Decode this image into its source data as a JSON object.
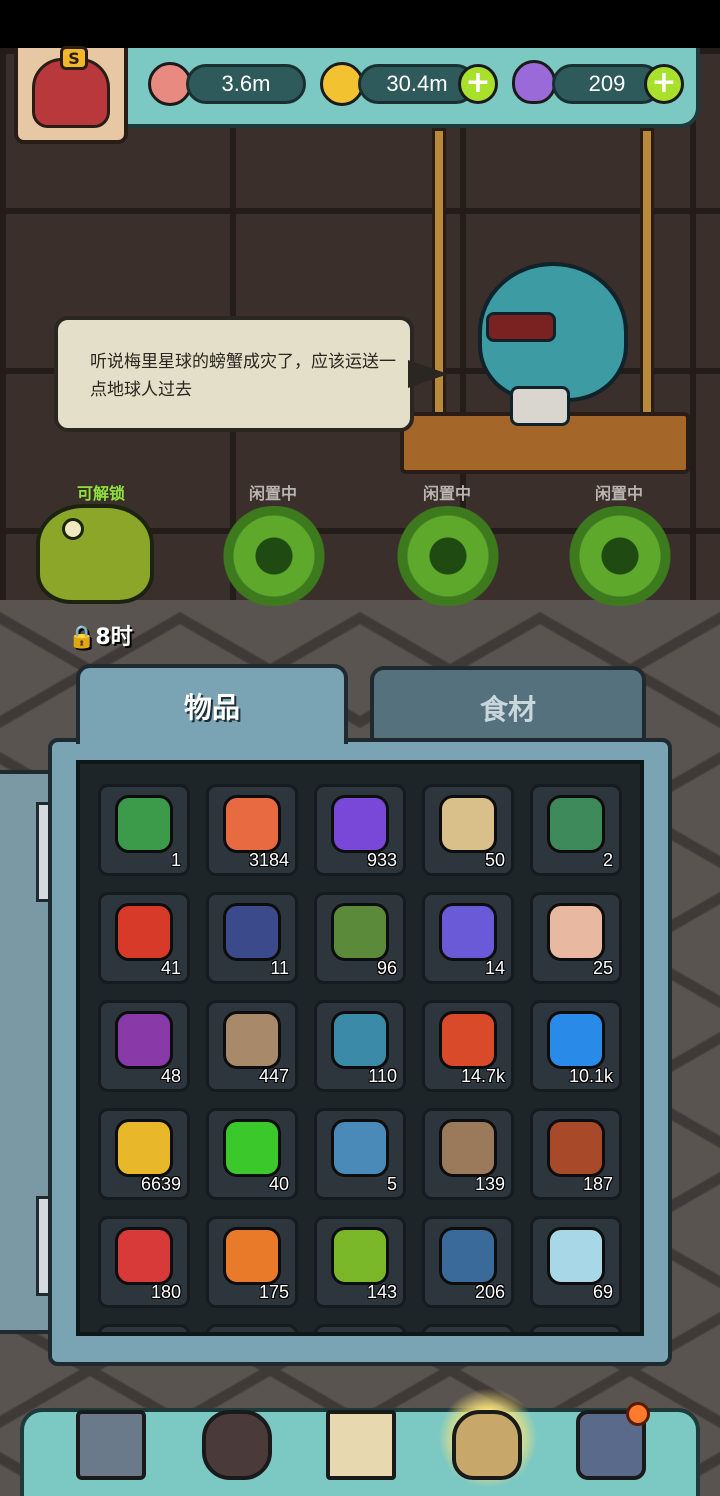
{
  "header": {
    "avatar_badge": "S",
    "resources": [
      {
        "name": "eye-currency",
        "value": "3.6m",
        "icon": "eyeball-icon",
        "color": "#e88a80"
      },
      {
        "name": "gold-coin",
        "value": "30.4m",
        "icon": "coin-icon",
        "color": "#f2c230"
      },
      {
        "name": "potion",
        "value": "209",
        "icon": "potion-icon",
        "color": "#9a6ad8"
      }
    ],
    "plus_label": "+"
  },
  "dialogue": {
    "text": "听说梅里星球的螃蟹成灾了，应该运送一点地球人过去"
  },
  "slots": [
    {
      "status": "可解锁",
      "status_color": "#8ee23a",
      "timer": "8时"
    },
    {
      "status": "闲置中",
      "status_color": "#b9b4b0"
    },
    {
      "status": "闲置中",
      "status_color": "#b9b4b0"
    },
    {
      "status": "闲置中",
      "status_color": "#b9b4b0"
    }
  ],
  "tabs": [
    {
      "label": "物品",
      "active": true
    },
    {
      "label": "食材",
      "active": false
    }
  ],
  "items": [
    {
      "icon": "bottle-icon",
      "count": "1",
      "color": "#3c9b4a"
    },
    {
      "icon": "meat-icon",
      "count": "3184",
      "color": "#e86a40"
    },
    {
      "icon": "purple-powder-icon",
      "count": "933",
      "color": "#7a48d8"
    },
    {
      "icon": "map-scroll-icon",
      "count": "50",
      "color": "#d9c08a"
    },
    {
      "icon": "film-card-icon",
      "count": "2",
      "color": "#3e8a5a"
    },
    {
      "icon": "oil-barrel-icon",
      "count": "41",
      "color": "#d83a2a"
    },
    {
      "icon": "blue-card-icon",
      "count": "11",
      "color": "#3a4a8a"
    },
    {
      "icon": "cauldron-card-icon",
      "count": "96",
      "color": "#5a8a3a"
    },
    {
      "icon": "crystal-cluster-icon",
      "count": "14",
      "color": "#6a5ad8"
    },
    {
      "icon": "recipe-scroll-icon",
      "count": "25",
      "color": "#e8b8a0"
    },
    {
      "icon": "mosaic-card-icon",
      "count": "48",
      "color": "#8a3aa8"
    },
    {
      "icon": "furry-box-icon",
      "count": "447",
      "color": "#a88a6a"
    },
    {
      "icon": "fuzzy-token-icon",
      "count": "110",
      "color": "#3a8aa8"
    },
    {
      "icon": "red-triangle-gem-icon",
      "count": "14.7k",
      "color": "#d84a2a"
    },
    {
      "icon": "blue-square-gem-icon",
      "count": "10.1k",
      "color": "#2a8ae8"
    },
    {
      "icon": "yellow-pentagon-gem-icon",
      "count": "6639",
      "color": "#e8b82a"
    },
    {
      "icon": "green-hexagon-gem-icon",
      "count": "40",
      "color": "#3ac82a"
    },
    {
      "icon": "gear-machine-icon",
      "count": "5",
      "color": "#4a8ab8"
    },
    {
      "icon": "worm-rope-icon",
      "count": "139",
      "color": "#9a7a5a"
    },
    {
      "icon": "guitar-icon",
      "count": "187",
      "color": "#a84a2a"
    },
    {
      "icon": "red-spiky-creature-icon",
      "count": "180",
      "color": "#d83a3a"
    },
    {
      "icon": "orange-feather-icon",
      "count": "175",
      "color": "#e87a2a"
    },
    {
      "icon": "green-plant-icon",
      "count": "143",
      "color": "#7ab82a"
    },
    {
      "icon": "blue-caterpillar-icon",
      "count": "206",
      "color": "#3a6a9a"
    },
    {
      "icon": "pearl-icon",
      "count": "69",
      "color": "#a8d8e8"
    }
  ],
  "nav": [
    {
      "name": "shop",
      "icon": "shop-building-icon",
      "color": "#6a7a8a"
    },
    {
      "name": "monster",
      "icon": "fire-monster-icon",
      "color": "#4a3a3a"
    },
    {
      "name": "book",
      "icon": "open-book-icon",
      "color": "#e8d8b0"
    },
    {
      "name": "bag",
      "icon": "coin-bag-icon",
      "color": "#c8a86a",
      "active": true
    },
    {
      "name": "menu",
      "icon": "grid-menu-icon",
      "color": "#5a6a8a",
      "notification": true
    }
  ]
}
